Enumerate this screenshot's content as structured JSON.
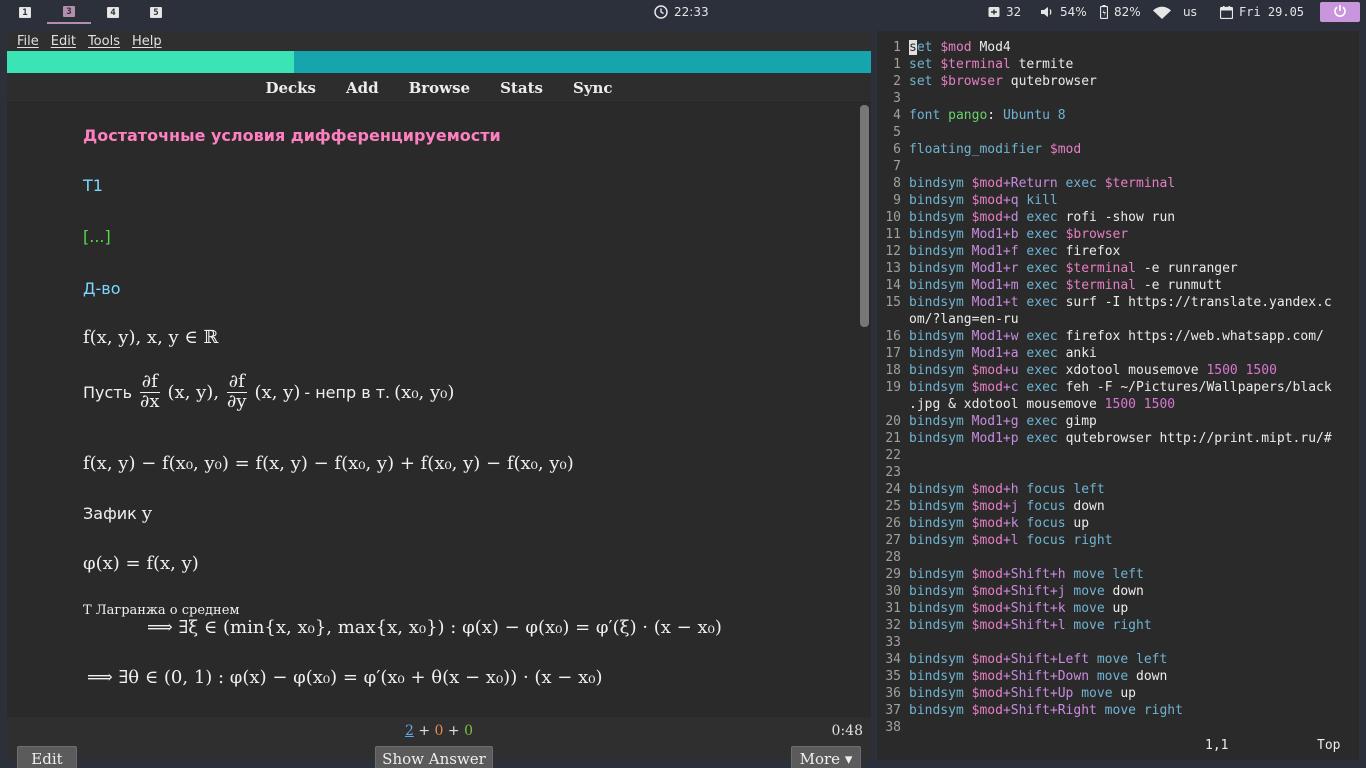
{
  "topbar": {
    "workspaces": [
      {
        "label": "1",
        "active": false
      },
      {
        "label": "3",
        "active": true
      },
      {
        "label": "4",
        "active": false
      },
      {
        "label": "5",
        "active": false
      }
    ],
    "clock_icon": "clock-icon",
    "time": "22:33",
    "inbox_count": "32",
    "volume": "54%",
    "battery": "82%",
    "wifi_icon": "wifi-icon",
    "keyboard_layout": "us",
    "date": "Fri 29.05",
    "power_icon": "power-icon",
    "accent_color": "#b48ead"
  },
  "anki": {
    "menu": [
      "File",
      "Edit",
      "Tools",
      "Help"
    ],
    "nav": [
      "Decks",
      "Add",
      "Browse",
      "Stats",
      "Sync"
    ],
    "card": {
      "title": "Достаточные условия дифференцируемости",
      "t1": "T1",
      "cloze": "[...]",
      "proof": "Д-во",
      "line_f": "f(x, y), x, y ∈ ℝ",
      "let_word": "Пусть",
      "df": "∂f",
      "dx": "∂x",
      "dy": "∂y",
      "xy_args": "(x, y),",
      "xy_args2": "(x, y)",
      "cont_text": "- непр в т.",
      "point": "(x₀, y₀)",
      "difference": "f(x, y) − f(x₀, y₀) = f(x, y) − f(x₀, y) + f(x₀, y) − f(x₀, y₀)",
      "fix_word": "Зафик",
      "fix_var": "y",
      "phi": "φ(x) = f(x, y)",
      "lagrange_label": "Т Лагранжа о среднем",
      "lagrange_formula": "⟹   ∃ξ ∈ (min{x, x₀}, max{x, x₀}) : φ(x) − φ(x₀) = φ′(ξ) · (x − x₀)",
      "theta_formula": "⟹  ∃θ ∈ (0, 1) : φ(x) − φ(x₀) = φ′(x₀ + θ(x − x₀)) · (x − x₀)"
    },
    "counts": {
      "new": "2",
      "plus1": "+",
      "learn": "0",
      "plus2": "+",
      "review": "0"
    },
    "timer": "0:48",
    "buttons": {
      "edit": "Edit",
      "show_answer": "Show Answer",
      "more": "More ▾"
    }
  },
  "vim": {
    "lines": [
      {
        "n": "1",
        "parts": [
          [
            "cursor",
            "s"
          ],
          [
            "kw",
            "et "
          ],
          [
            "var",
            "$mod"
          ],
          [
            "txt",
            " Mod4"
          ]
        ]
      },
      {
        "n": "1",
        "parts": [
          [
            "kw",
            "set "
          ],
          [
            "var",
            "$terminal"
          ],
          [
            "txt",
            " termite"
          ]
        ]
      },
      {
        "n": "2",
        "parts": [
          [
            "kw",
            "set "
          ],
          [
            "var",
            "$browser"
          ],
          [
            "txt",
            " qutebrowser"
          ]
        ]
      },
      {
        "n": "3",
        "parts": []
      },
      {
        "n": "4",
        "parts": [
          [
            "kw",
            "font "
          ],
          [
            "grn",
            "pango"
          ],
          [
            "txt",
            ": "
          ],
          [
            "kw",
            "Ubuntu 8"
          ]
        ]
      },
      {
        "n": "5",
        "parts": []
      },
      {
        "n": "6",
        "parts": [
          [
            "kw",
            "floating_modifier "
          ],
          [
            "var",
            "$mod"
          ]
        ]
      },
      {
        "n": "7",
        "parts": []
      },
      {
        "n": "8",
        "parts": [
          [
            "kw",
            "bindsym "
          ],
          [
            "var",
            "$mod"
          ],
          [
            "mag",
            "+Return"
          ],
          [
            "kw",
            " exec "
          ],
          [
            "var",
            "$terminal"
          ]
        ]
      },
      {
        "n": "9",
        "parts": [
          [
            "kw",
            "bindsym "
          ],
          [
            "var",
            "$mod"
          ],
          [
            "mag",
            "+q"
          ],
          [
            "kw",
            " kill"
          ]
        ]
      },
      {
        "n": "10",
        "parts": [
          [
            "kw",
            "bindsym "
          ],
          [
            "var",
            "$mod"
          ],
          [
            "mag",
            "+d"
          ],
          [
            "kw",
            " exec "
          ],
          [
            "txt",
            "rofi -show run"
          ]
        ]
      },
      {
        "n": "11",
        "parts": [
          [
            "kw",
            "bindsym "
          ],
          [
            "mag",
            "Mod1+b"
          ],
          [
            "kw",
            " exec "
          ],
          [
            "var",
            "$browser"
          ]
        ]
      },
      {
        "n": "12",
        "parts": [
          [
            "kw",
            "bindsym "
          ],
          [
            "mag",
            "Mod1+f"
          ],
          [
            "kw",
            " exec "
          ],
          [
            "txt",
            "firefox"
          ]
        ]
      },
      {
        "n": "13",
        "parts": [
          [
            "kw",
            "bindsym "
          ],
          [
            "mag",
            "Mod1+r"
          ],
          [
            "kw",
            " exec "
          ],
          [
            "var",
            "$terminal"
          ],
          [
            "txt",
            " -e runranger"
          ]
        ]
      },
      {
        "n": "14",
        "parts": [
          [
            "kw",
            "bindsym "
          ],
          [
            "mag",
            "Mod1+m"
          ],
          [
            "kw",
            " exec "
          ],
          [
            "var",
            "$terminal"
          ],
          [
            "txt",
            " -e runmutt"
          ]
        ]
      },
      {
        "n": "15",
        "parts": [
          [
            "kw",
            "bindsym "
          ],
          [
            "mag",
            "Mod1+t"
          ],
          [
            "kw",
            " exec "
          ],
          [
            "txt",
            "surf -I https://translate.yandex.c"
          ]
        ]
      },
      {
        "n": "",
        "parts": [
          [
            "txt",
            "om/?lang=en-ru"
          ]
        ]
      },
      {
        "n": "16",
        "parts": [
          [
            "kw",
            "bindsym "
          ],
          [
            "mag",
            "Mod1+w"
          ],
          [
            "kw",
            " exec "
          ],
          [
            "txt",
            "firefox https://web.whatsapp.com/"
          ]
        ]
      },
      {
        "n": "17",
        "parts": [
          [
            "kw",
            "bindsym "
          ],
          [
            "mag",
            "Mod1+a"
          ],
          [
            "kw",
            " exec "
          ],
          [
            "txt",
            "anki"
          ]
        ]
      },
      {
        "n": "18",
        "parts": [
          [
            "kw",
            "bindsym "
          ],
          [
            "var",
            "$mod"
          ],
          [
            "mag",
            "+u"
          ],
          [
            "kw",
            " exec "
          ],
          [
            "txt",
            "xdotool mousemove "
          ],
          [
            "num2",
            "1500 1500"
          ]
        ]
      },
      {
        "n": "19",
        "parts": [
          [
            "kw",
            "bindsym "
          ],
          [
            "var",
            "$mod"
          ],
          [
            "mag",
            "+c"
          ],
          [
            "kw",
            " exec "
          ],
          [
            "txt",
            "feh -F ~/Pictures/Wallpapers/black"
          ]
        ]
      },
      {
        "n": "",
        "parts": [
          [
            "txt",
            ".jpg & xdotool mousemove "
          ],
          [
            "num2",
            "1500 1500"
          ]
        ]
      },
      {
        "n": "20",
        "parts": [
          [
            "kw",
            "bindsym "
          ],
          [
            "mag",
            "Mod1+g"
          ],
          [
            "kw",
            " exec "
          ],
          [
            "txt",
            "gimp"
          ]
        ]
      },
      {
        "n": "21",
        "parts": [
          [
            "kw",
            "bindsym "
          ],
          [
            "mag",
            "Mod1+p"
          ],
          [
            "kw",
            " exec "
          ],
          [
            "txt",
            "qutebrowser http://print.mipt.ru/#"
          ]
        ]
      },
      {
        "n": "22",
        "parts": []
      },
      {
        "n": "23",
        "parts": []
      },
      {
        "n": "24",
        "parts": [
          [
            "kw",
            "bindsym "
          ],
          [
            "var",
            "$mod"
          ],
          [
            "mag",
            "+h"
          ],
          [
            "kw",
            " focus "
          ],
          [
            "kw",
            "left"
          ]
        ]
      },
      {
        "n": "25",
        "parts": [
          [
            "kw",
            "bindsym "
          ],
          [
            "var",
            "$mod"
          ],
          [
            "mag",
            "+j"
          ],
          [
            "kw",
            " focus "
          ],
          [
            "txt",
            "down"
          ]
        ]
      },
      {
        "n": "26",
        "parts": [
          [
            "kw",
            "bindsym "
          ],
          [
            "var",
            "$mod"
          ],
          [
            "mag",
            "+k"
          ],
          [
            "kw",
            " focus "
          ],
          [
            "txt",
            "up"
          ]
        ]
      },
      {
        "n": "27",
        "parts": [
          [
            "kw",
            "bindsym "
          ],
          [
            "var",
            "$mod"
          ],
          [
            "mag",
            "+l"
          ],
          [
            "kw",
            " focus "
          ],
          [
            "kw",
            "right"
          ]
        ]
      },
      {
        "n": "28",
        "parts": []
      },
      {
        "n": "29",
        "parts": [
          [
            "kw",
            "bindsym "
          ],
          [
            "var",
            "$mod"
          ],
          [
            "mag",
            "+Shift+h"
          ],
          [
            "kw",
            " move "
          ],
          [
            "kw",
            "left"
          ]
        ]
      },
      {
        "n": "30",
        "parts": [
          [
            "kw",
            "bindsym "
          ],
          [
            "var",
            "$mod"
          ],
          [
            "mag",
            "+Shift+j"
          ],
          [
            "kw",
            " move "
          ],
          [
            "txt",
            "down"
          ]
        ]
      },
      {
        "n": "31",
        "parts": [
          [
            "kw",
            "bindsym "
          ],
          [
            "var",
            "$mod"
          ],
          [
            "mag",
            "+Shift+k"
          ],
          [
            "kw",
            " move "
          ],
          [
            "txt",
            "up"
          ]
        ]
      },
      {
        "n": "32",
        "parts": [
          [
            "kw",
            "bindsym "
          ],
          [
            "var",
            "$mod"
          ],
          [
            "mag",
            "+Shift+l"
          ],
          [
            "kw",
            " move "
          ],
          [
            "kw",
            "right"
          ]
        ]
      },
      {
        "n": "33",
        "parts": []
      },
      {
        "n": "34",
        "parts": [
          [
            "kw",
            "bindsym "
          ],
          [
            "var",
            "$mod"
          ],
          [
            "mag",
            "+Shift+Left"
          ],
          [
            "kw",
            " move "
          ],
          [
            "kw",
            "left"
          ]
        ]
      },
      {
        "n": "35",
        "parts": [
          [
            "kw",
            "bindsym "
          ],
          [
            "var",
            "$mod"
          ],
          [
            "mag",
            "+Shift+Down"
          ],
          [
            "kw",
            " move "
          ],
          [
            "txt",
            "down"
          ]
        ]
      },
      {
        "n": "36",
        "parts": [
          [
            "kw",
            "bindsym "
          ],
          [
            "var",
            "$mod"
          ],
          [
            "mag",
            "+Shift+Up"
          ],
          [
            "kw",
            " move "
          ],
          [
            "txt",
            "up"
          ]
        ]
      },
      {
        "n": "37",
        "parts": [
          [
            "kw",
            "bindsym "
          ],
          [
            "var",
            "$mod"
          ],
          [
            "mag",
            "+Shift+Right"
          ],
          [
            "kw",
            " move "
          ],
          [
            "kw",
            "right"
          ]
        ]
      },
      {
        "n": "38",
        "parts": []
      }
    ],
    "status_pos": "1,1",
    "status_scroll": "Top"
  }
}
